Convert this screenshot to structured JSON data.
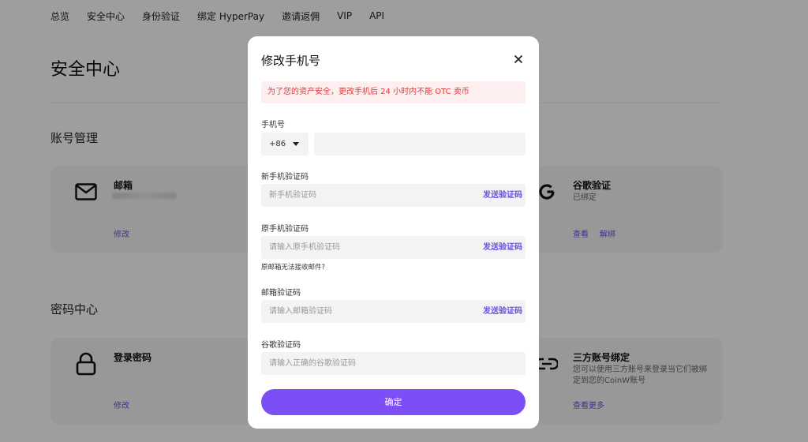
{
  "nav": {
    "items": [
      "总览",
      "安全中心",
      "身份验证",
      "绑定 HyperPay",
      "邀请返佣",
      "VIP",
      "API"
    ]
  },
  "page": {
    "title": "安全中心",
    "account_section": "账号管理",
    "password_section": "密码中心"
  },
  "cards": {
    "email": {
      "title": "邮箱",
      "link": "修改",
      "icon": "mail-icon"
    },
    "google": {
      "title": "谷歌验证",
      "status": "已绑定",
      "link_view": "查看",
      "link_unbind": "解绑",
      "icon": "google-icon"
    },
    "login_password": {
      "title": "登录密码",
      "link": "修改",
      "icon": "lock-icon"
    },
    "third_party": {
      "title": "三方账号绑定",
      "desc": "您可以使用三方账号来登录当它们被绑定到您的CoinW账号",
      "link": "查看更多",
      "icon": "link-icon"
    }
  },
  "modal": {
    "title": "修改手机号",
    "warning": "为了您的资产安全，更改手机后 24 小时内不能 OTC 卖币",
    "phone_label": "手机号",
    "country_code": "+86",
    "phone_value": "",
    "new_code_label": "新手机验证码",
    "new_code_placeholder": "新手机验证码",
    "old_code_label": "原手机验证码",
    "old_code_placeholder": "请输入原手机验证码",
    "email_hint": "原邮箱无法接收邮件?",
    "email_code_label": "邮箱验证码",
    "email_code_placeholder": "请输入邮箱验证码",
    "google_code_label": "谷歌验证码",
    "google_code_placeholder": "请输入正确的谷歌验证码",
    "send_code": "发送验证码",
    "confirm": "确定"
  },
  "colors": {
    "accent": "#7b4ff5",
    "link": "#6b4fe0",
    "warning_text": "#e4393c",
    "warning_bg": "#fdeff0"
  }
}
